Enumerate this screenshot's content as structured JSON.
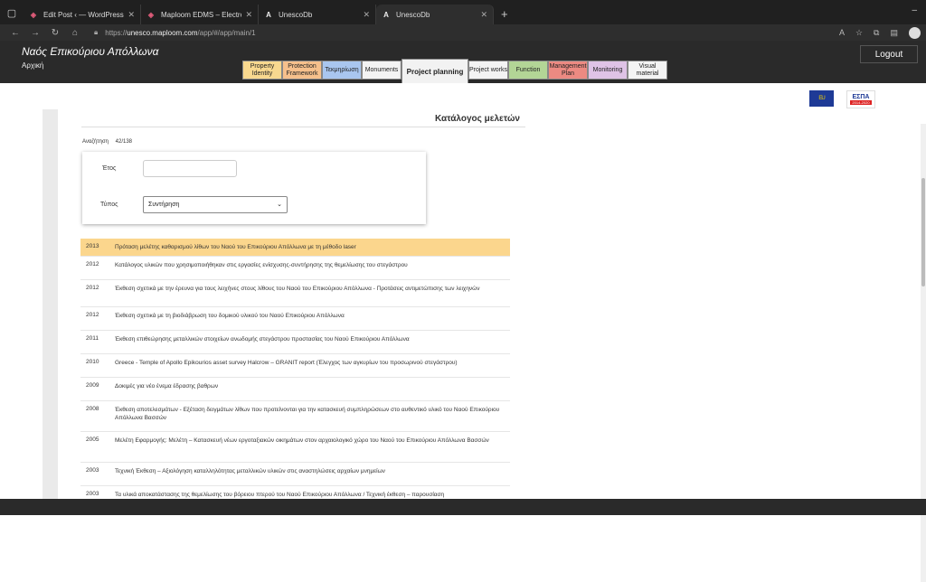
{
  "browser": {
    "tabs": [
      {
        "title": "Edit Post ‹ — WordPress",
        "icon": "wordpress-icon"
      },
      {
        "title": "Maploom EDMS – Electronic Doc",
        "icon": "maploom-icon"
      },
      {
        "title": "UnescoDb",
        "icon": "unesco-icon"
      },
      {
        "title": "UnescoDb",
        "icon": "unesco-icon",
        "active": true
      }
    ],
    "url_prefix": "https://",
    "url_host": "unesco.maploom.com",
    "url_path": "/app/#/app/main/1"
  },
  "header": {
    "title": "Ναός Επικούριου Απόλλωνα",
    "subtitle": "Αρχική",
    "logout_label": "Logout",
    "nav": [
      {
        "label": "Property Identity",
        "color": "#f8d88f",
        "width": 44
      },
      {
        "label": "Protection Framework",
        "color": "#f6c08c",
        "width": 44
      },
      {
        "label": "Τεκμηρίωση",
        "color": "#a9c6ef",
        "width": 44
      },
      {
        "label": "Monuments",
        "color": "#f3f3f3",
        "width": 44
      },
      {
        "label": "Project planning",
        "color": "#f2f2f2",
        "width": 74,
        "active": true
      },
      {
        "label": "Project works",
        "color": "#f3f3f3",
        "width": 44
      },
      {
        "label": "Function",
        "color": "#b3d596",
        "width": 44
      },
      {
        "label": "Management Plan",
        "color": "#ec8a82",
        "width": 44
      },
      {
        "label": "Monitoring",
        "color": "#dfc3e6",
        "width": 44
      },
      {
        "label": "Visual material",
        "color": "#f3f3f3",
        "width": 44
      }
    ]
  },
  "logos": {
    "eu": "EU",
    "espa": "ΕΣΠΑ",
    "espa_years": "2014-2020"
  },
  "main": {
    "title": "Κατάλογος μελετών",
    "search_label": "Αναζήτηση",
    "search_count": "42/138",
    "filter": {
      "year_label": "Έτος",
      "year_value": "",
      "type_label": "Τύπος",
      "type_value": "Συντήρηση"
    },
    "studies": [
      {
        "year": "2013",
        "title": "Πρόταση μελέτης καθαρισμού λίθων του Ναού του Επικούριου Απόλλωνα με τη μέθοδο laser",
        "highlight": true
      },
      {
        "year": "2012",
        "title": "Κατάλογος υλικών που χρησιμοποιήθηκαν στις εργασίες ενίσχυσης-συντήρησης της θεμελίωσης του στεγάστρου"
      },
      {
        "year": "2012",
        "title": "Έκθεση σχετικά με την έρευνα για τους λειχήνες στους λίθους του Ναού του Επικούριου Απόλλωνα - Προτάσεις αντιμετώπισης των λειχηνών"
      },
      {
        "year": "2012",
        "title": "Έκθεση σχετικά με τη βιοδιάβρωση του δομικού υλικού του Ναού Επικούριου Απόλλωνα"
      },
      {
        "year": "2011",
        "title": "Έκθεση επιθεώρησης μεταλλικών στοιχείων ανωδομής στεγάστρου προστασίας του Ναού Επικούριου Απόλλωνα"
      },
      {
        "year": "2010",
        "title": "Greece - Temple of Apollo Epikourios asset survey Halcrow – GRANIT report (Έλεγχος των αγκυρίων του προσωρινού στεγάστρου)"
      },
      {
        "year": "2009",
        "title": "Δοκιμές για νέο ένεμα έδρασης βαθρων"
      },
      {
        "year": "2008",
        "title": "Έκθεση αποτελεσμάτων - Εξέταση δειγμάτων λίθων που προτείνονται για την κατασκευή συμπληρώσεων στο αυθεντικό υλικό του Ναού Επικούριου Απόλλωνα Βασσών"
      },
      {
        "year": "2005",
        "title": "Μελέτη Εφαρμογής: Μελέτη – Κατασκευή νέων εργοταξιακών οικημάτων στον αρχαιολογικό χώρο του Ναού του Επικούριου Απόλλωνα Βασσών"
      },
      {
        "year": "2003",
        "title": "Τεχνική Έκθεση – Αξιολόγηση καταλληλότητας μεταλλικών υλικών στις αναστηλώσεις αρχαίων μνημείων"
      },
      {
        "year": "2003",
        "title": "Τα υλικά αποκατάστασης της θεμελίωσης του βόρειου πτερού του Ναού Επικούριου Απόλλωνα / Τεχνική έκθεση – παρουσίαση"
      }
    ]
  }
}
